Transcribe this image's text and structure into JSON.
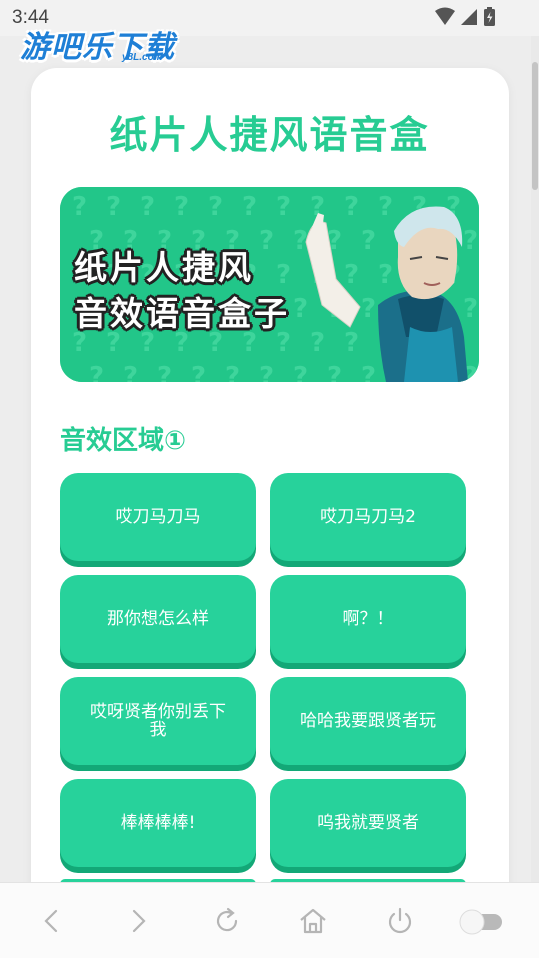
{
  "status_bar": {
    "time": "3:44"
  },
  "watermark": {
    "text": "游吧乐下载",
    "sub": "y8L.com"
  },
  "page": {
    "title": "纸片人捷风语音盒"
  },
  "banner": {
    "line1": "纸片人捷风",
    "line2": "音效语音盒子"
  },
  "section": {
    "title": "音效区域①"
  },
  "buttons": [
    {
      "label": "哎刀马刀马"
    },
    {
      "label": "哎刀马刀马2"
    },
    {
      "label": "那你想怎么样"
    },
    {
      "label": "啊？！"
    },
    {
      "label": "哎呀贤者你别丢下我"
    },
    {
      "label": "哈哈我要跟贤者玩"
    },
    {
      "label": "棒棒棒棒!"
    },
    {
      "label": "呜我就要贤者"
    }
  ],
  "nav": {
    "icons": [
      "back-icon",
      "forward-icon",
      "refresh-icon",
      "home-icon",
      "power-icon",
      "toggle-switch"
    ]
  },
  "colors": {
    "accent": "#27cc93",
    "button": "#27d29b",
    "button_shadow": "#13a877"
  }
}
